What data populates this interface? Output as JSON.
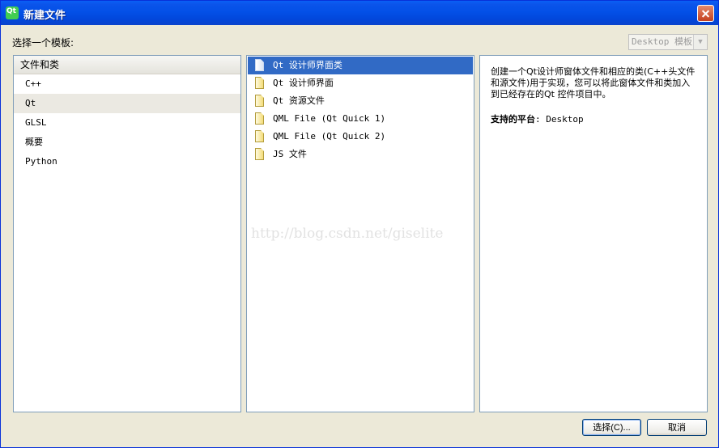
{
  "window": {
    "title": "新建文件"
  },
  "choose_template_label": "选择一个模板:",
  "template_filter": {
    "selected": "Desktop 模板"
  },
  "categories": {
    "header": "文件和类",
    "items": [
      {
        "label": "C++",
        "selected": false
      },
      {
        "label": "Qt",
        "selected": true
      },
      {
        "label": "GLSL",
        "selected": false
      },
      {
        "label": "概要",
        "selected": false
      },
      {
        "label": "Python",
        "selected": false
      }
    ]
  },
  "templates": {
    "items": [
      {
        "label": "Qt 设计师界面类",
        "selected": true
      },
      {
        "label": "Qt 设计师界面",
        "selected": false
      },
      {
        "label": "Qt 资源文件",
        "selected": false
      },
      {
        "label": "QML File (Qt Quick 1)",
        "selected": false
      },
      {
        "label": "QML File (Qt Quick 2)",
        "selected": false
      },
      {
        "label": "JS 文件",
        "selected": false
      }
    ]
  },
  "description": {
    "text": "创建一个Qt设计师窗体文件和相应的类(C++头文件和源文件)用于实现，您可以将此窗体文件和类加入到已经存在的Qt 控件项目中。",
    "platform_label": "支持的平台",
    "platform_value": ": Desktop"
  },
  "watermark": "http://blog.csdn.net/giselite",
  "buttons": {
    "select": "选择(C)...",
    "cancel": "取消"
  },
  "colors": {
    "selection": "#316ac5",
    "title_bar": "#0350e7",
    "panel_border": "#7f9db9"
  }
}
